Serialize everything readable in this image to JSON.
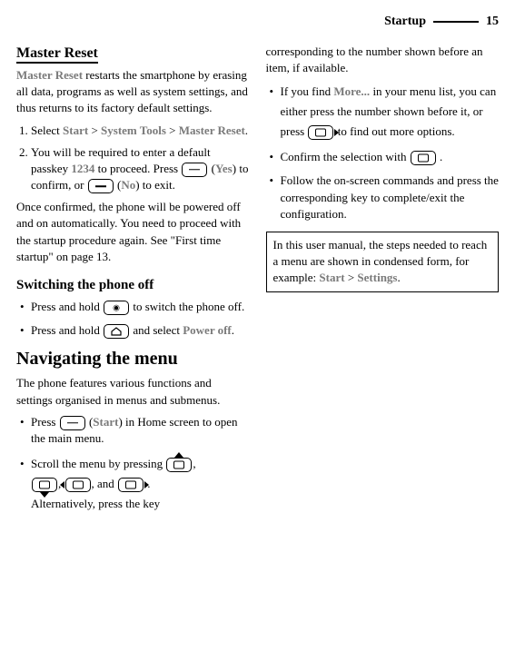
{
  "header": {
    "section": "Startup",
    "page": "15"
  },
  "col1": {
    "masterReset": {
      "heading": "Master Reset",
      "intro_gray": "Master Reset",
      "intro_rest": " restarts the smartphone by erasing all data, programs as well as system settings, and thus returns to its factory default settings.",
      "step1_pre": "Select ",
      "step1_start": "Start",
      "gt": " > ",
      "step1_tools": "System Tools",
      "step1_reset": "Master Reset",
      "step1_post": ".",
      "step2_pre": "You will be required to enter a default passkey ",
      "step2_passkey": "1234",
      "step2_mid": " to proceed. Press ",
      "step2_yes": "Yes",
      "step2_mid2": ") to confirm, or ",
      "step2_no": "No",
      "step2_post": ") to exit.",
      "outro": "Once confirmed, the phone will be powered off and on automatically. You need to proceed with the startup procedure again. See \"First time startup\" on page 13."
    },
    "switchOff": {
      "heading": "Switching the phone off",
      "b1_pre": "Press and hold ",
      "b1_post": " to switch the phone off.",
      "b2_pre": "Press and hold ",
      "b2_mid": " and select ",
      "b2_poweroff": "Power off",
      "b2_post": "."
    },
    "navMenu": {
      "heading": "Navigating the menu",
      "intro": "The phone features various functions and settings organised in menus and submenus.",
      "b1_pre": "Press ",
      "b1_start": "Start",
      "b1_post": ") in Home screen to open the main menu.",
      "b2_pre": "Scroll the menu by pressing ",
      "b2_and": ", and ",
      "b2_comma": ", ",
      "b2_sep": ",  ",
      "b2_period": " .",
      "b2_alt": "Alternatively, press the key"
    }
  },
  "col2": {
    "p1": "corresponding to the number shown before an item, if available.",
    "b1_pre": "If you find ",
    "b1_more": "More...",
    "b1_mid": " in your menu list, you can either press the number shown before it, or press ",
    "b1_post": "  to find out more options.",
    "b2_pre": "Confirm the selection with ",
    "b2_post": " .",
    "b3": "Follow the on-screen commands and press the corresponding key to complete/exit the configuration.",
    "note_pre": "In this user manual, the steps needed to reach a menu are shown in condensed form, for example: ",
    "note_start": "Start",
    "note_gt": " > ",
    "note_settings": "Settings",
    "note_post": "."
  }
}
